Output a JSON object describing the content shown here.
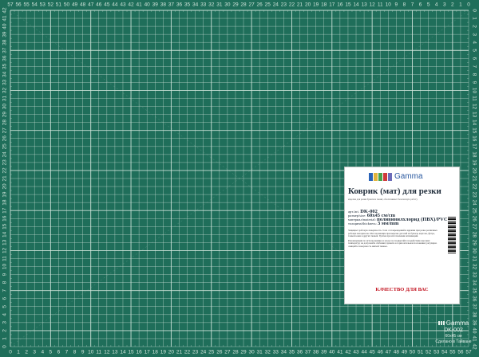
{
  "colors": {
    "mat": "#1f6e5a",
    "grid": "#d4e6dd",
    "edge": "#14503f",
    "label_bg": "#ffffff",
    "accent_red": "#c2121f",
    "logo_blocks": [
      "#2a63b8",
      "#e1b33a",
      "#4aa24a",
      "#cf3a3a",
      "#6b6bb8"
    ]
  },
  "ruler": {
    "min": 0,
    "max": 57,
    "left_min": 0,
    "left_max": 42
  },
  "label": {
    "brand": "Gamma",
    "title": "Коврик (мат) для резки",
    "subtitle": "изделие для резки бумаги и ткани; обеспечивает безопасную работу",
    "article_prefix": "арт./art.",
    "article": "DK-002",
    "size_prefix": "размер/size:",
    "size": "60x45 см/cm",
    "material_prefix": "материал/material:",
    "material": "поливинилхлорид (ПВХ)/PVC",
    "thickness_prefix": "толщина/thickness:",
    "thickness": "3 мм/mm",
    "features": "Защищает рабочую поверхность стола от повреждений и царапин при резке различных рабочих материалов. Мат незаменим при вырезке деталей из бумаги, картона, фетра, тонкой кожи и других тканей. Удобен при изготовлении аппликаций.",
    "recommendations": "Рекомендации по использованию и уходу: не подвергайте воздействию высоких температур; не допускайте сгибания; храните в горизонтальном положении; регулярно очищайте поверхность мягкой тканью.",
    "quality": "КАЧЕСТВО ДЛЯ ВАС"
  },
  "brand_mark": {
    "name": "Gamma",
    "model": "DK-002",
    "size": "60x45 см",
    "origin": "Сделано в Тайване"
  }
}
